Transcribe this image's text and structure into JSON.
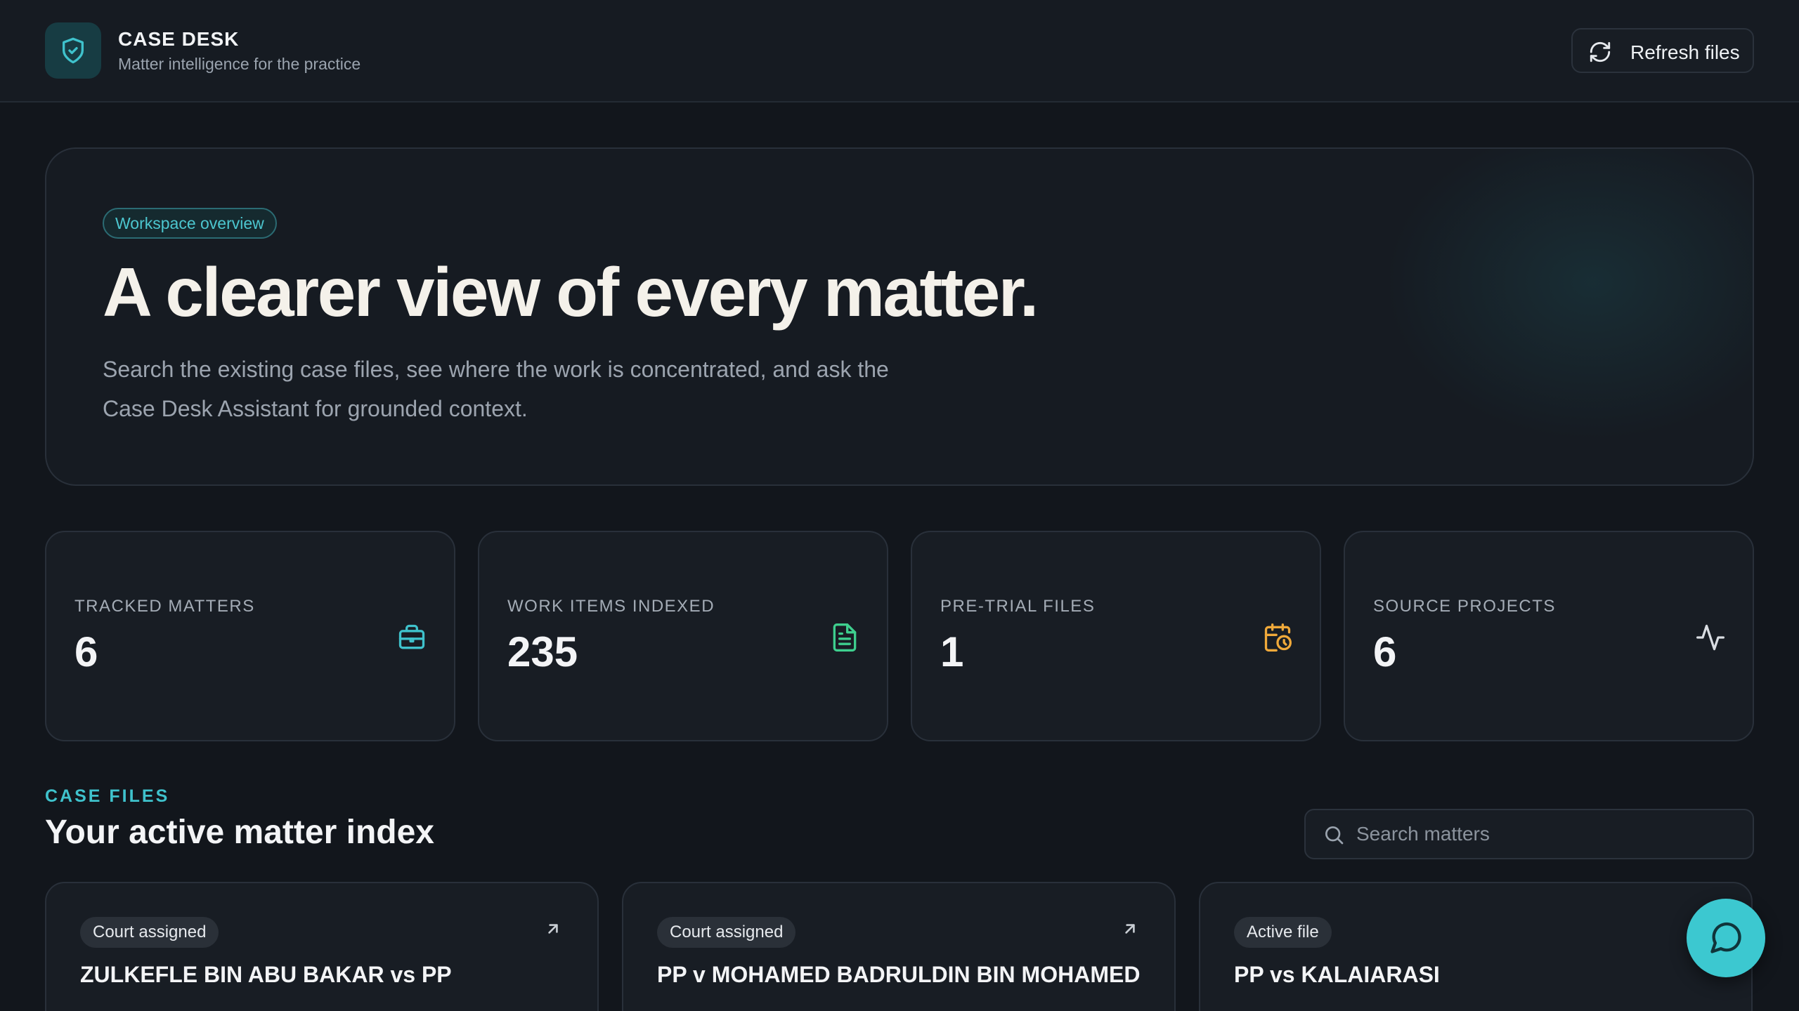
{
  "header": {
    "brand_title": "CASE DESK",
    "brand_subtitle": "Matter intelligence for the practice",
    "logo_icon": "shield-check-icon",
    "refresh_label": "Refresh files",
    "refresh_icon": "refresh-icon"
  },
  "hero": {
    "badge": "Workspace overview",
    "title": "A clearer view of every matter.",
    "description": "Search the existing case files, see where the work is concentrated, and ask the Case Desk Assistant for grounded context."
  },
  "stats": [
    {
      "label": "TRACKED MATTERS",
      "value": "6",
      "icon": "briefcase-icon",
      "color": "#3fc2cc"
    },
    {
      "label": "WORK ITEMS INDEXED",
      "value": "235",
      "icon": "document-icon",
      "color": "#3ecf8e"
    },
    {
      "label": "PRE-TRIAL FILES",
      "value": "1",
      "icon": "calendar-clock-icon",
      "color": "#f0a93a"
    },
    {
      "label": "SOURCE PROJECTS",
      "value": "6",
      "icon": "activity-icon",
      "color": "#d9dde2"
    }
  ],
  "case_files": {
    "eyebrow": "CASE FILES",
    "title": "Your active matter index",
    "search_placeholder": "Search matters",
    "cards": [
      {
        "status": "Court assigned",
        "title": "ZULKEFLE BIN ABU BAKAR vs PP"
      },
      {
        "status": "Court assigned",
        "title": "PP v MOHAMED BADRULDIN BIN MOHAMED"
      },
      {
        "status": "Active file",
        "title": "PP vs KALAIARASI"
      }
    ]
  },
  "chat": {
    "icon": "chat-bubble-icon"
  },
  "colors": {
    "accent": "#3cc8d0",
    "background": "#12161c",
    "panel": "#181d24"
  }
}
